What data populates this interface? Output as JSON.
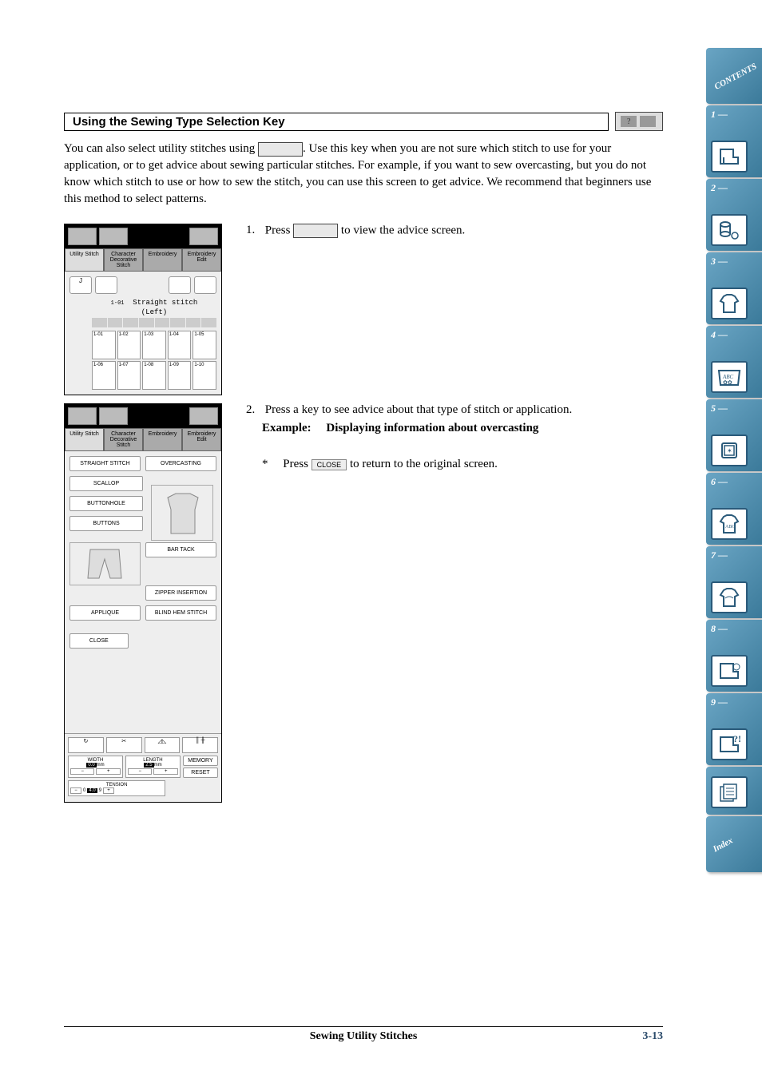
{
  "header": {
    "title": "Using the Sewing Type Selection Key"
  },
  "intro": {
    "part1": "You can also select utility stitches using ",
    "part2": ". Use this key when you are not sure which stitch to use for your application, or to get advice about sewing particular stitches. For example, if you want to sew overcasting, but you do not know which stitch to use or how to sew the stitch, you can use this screen to get advice. We recommend that beginners use this method to select patterns."
  },
  "step1": {
    "num": "1.",
    "text_a": "Press ",
    "text_b": " to view the advice screen."
  },
  "screenshot1": {
    "tabs": [
      "Utility Stitch",
      "Character Decorative Stitch",
      "Embroidery",
      "Embroidery Edit"
    ],
    "stitch_label_1": "Straight stitch",
    "stitch_label_2": "(Left)",
    "stitch_code": "1-01",
    "cells": [
      "1-01",
      "1-02",
      "1-03",
      "1-04",
      "1-05",
      "1-06",
      "1-07",
      "1-08",
      "1-09",
      "1-10"
    ]
  },
  "step2": {
    "num": "2.",
    "text": "Press a key to see advice about that type of stitch or application.",
    "example_label": "Example:",
    "example_text": "Displaying information about overcasting",
    "note_star": "*",
    "note_a": "Press ",
    "note_b": " to return to the original screen.",
    "close_label": "CLOSE"
  },
  "screenshot2": {
    "tabs": [
      "Utility Stitch",
      "Character Decorative Stitch",
      "Embroidery",
      "Embroidery Edit"
    ],
    "buttons": {
      "straight": "STRAIGHT STITCH",
      "overcasting": "OVERCASTING",
      "scallop": "SCALLOP",
      "buttonhole": "BUTTONHOLE",
      "buttons": "BUTTONS",
      "bartack": "BAR TACK",
      "zipper": "ZIPPER INSERTION",
      "applique": "APPLIQUE",
      "blindhem": "BLIND HEM STITCH",
      "close": "CLOSE"
    },
    "footer": {
      "width_label": "WIDTH",
      "width_val": "0.0",
      "width_unit": "mm",
      "length_label": "LENGTH",
      "length_val": "2.5",
      "length_unit": "mm",
      "tension_label": "TENSION",
      "tension_val": "4.0",
      "tension_min": "0",
      "tension_max": "9",
      "memory": "MEMORY",
      "reset": "RESET"
    }
  },
  "footer": {
    "title": "Sewing Utility Stitches",
    "pagenum": "3-13"
  },
  "nav": {
    "contents": "CONTENTS",
    "items": [
      "1 —",
      "2 —",
      "3 —",
      "4 —",
      "5 —",
      "6 —",
      "7 —",
      "8 —",
      "9 —"
    ],
    "index": "Index"
  }
}
